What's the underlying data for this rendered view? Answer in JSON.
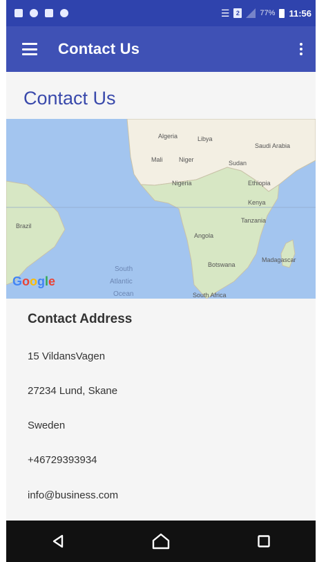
{
  "status_bar": {
    "battery_percent": "77%",
    "time": "11:56",
    "sim_badge": "2"
  },
  "app_bar": {
    "title": "Contact Us"
  },
  "page": {
    "title": "Contact Us"
  },
  "map": {
    "logo": "Google",
    "labels": {
      "algeria": "Algeria",
      "libya": "Libya",
      "saudi_arabia": "Saudi Arabia",
      "mali": "Mali",
      "niger": "Niger",
      "sudan": "Sudan",
      "nigeria": "Nigeria",
      "ethiopia": "Ethiopia",
      "kenya": "Kenya",
      "tanzania": "Tanzania",
      "angola": "Angola",
      "brazil": "Brazil",
      "botswana": "Botswana",
      "madagascar": "Madagascar",
      "south": "South",
      "atlantic": "Atlantic",
      "ocean": "Ocean",
      "south_africa": "South Africa"
    }
  },
  "contact": {
    "heading": "Contact Address",
    "street": "15 VildansVagen",
    "city": "27234 Lund, Skane",
    "country": "Sweden",
    "phone": "+46729393934",
    "email": "info@business.com"
  },
  "colors": {
    "status_bar": "#2f43ad",
    "app_bar": "#3f51b5",
    "title_text": "#3949ab",
    "background": "#f5f5f5",
    "nav_bar": "#111111",
    "ocean": "#a3c5ef",
    "land": "#f3efe3"
  },
  "icons": {
    "menu": "hamburger-icon",
    "overflow": "more-vert-icon",
    "back": "back-triangle-icon",
    "home": "home-icon",
    "recents": "recents-square-icon"
  }
}
